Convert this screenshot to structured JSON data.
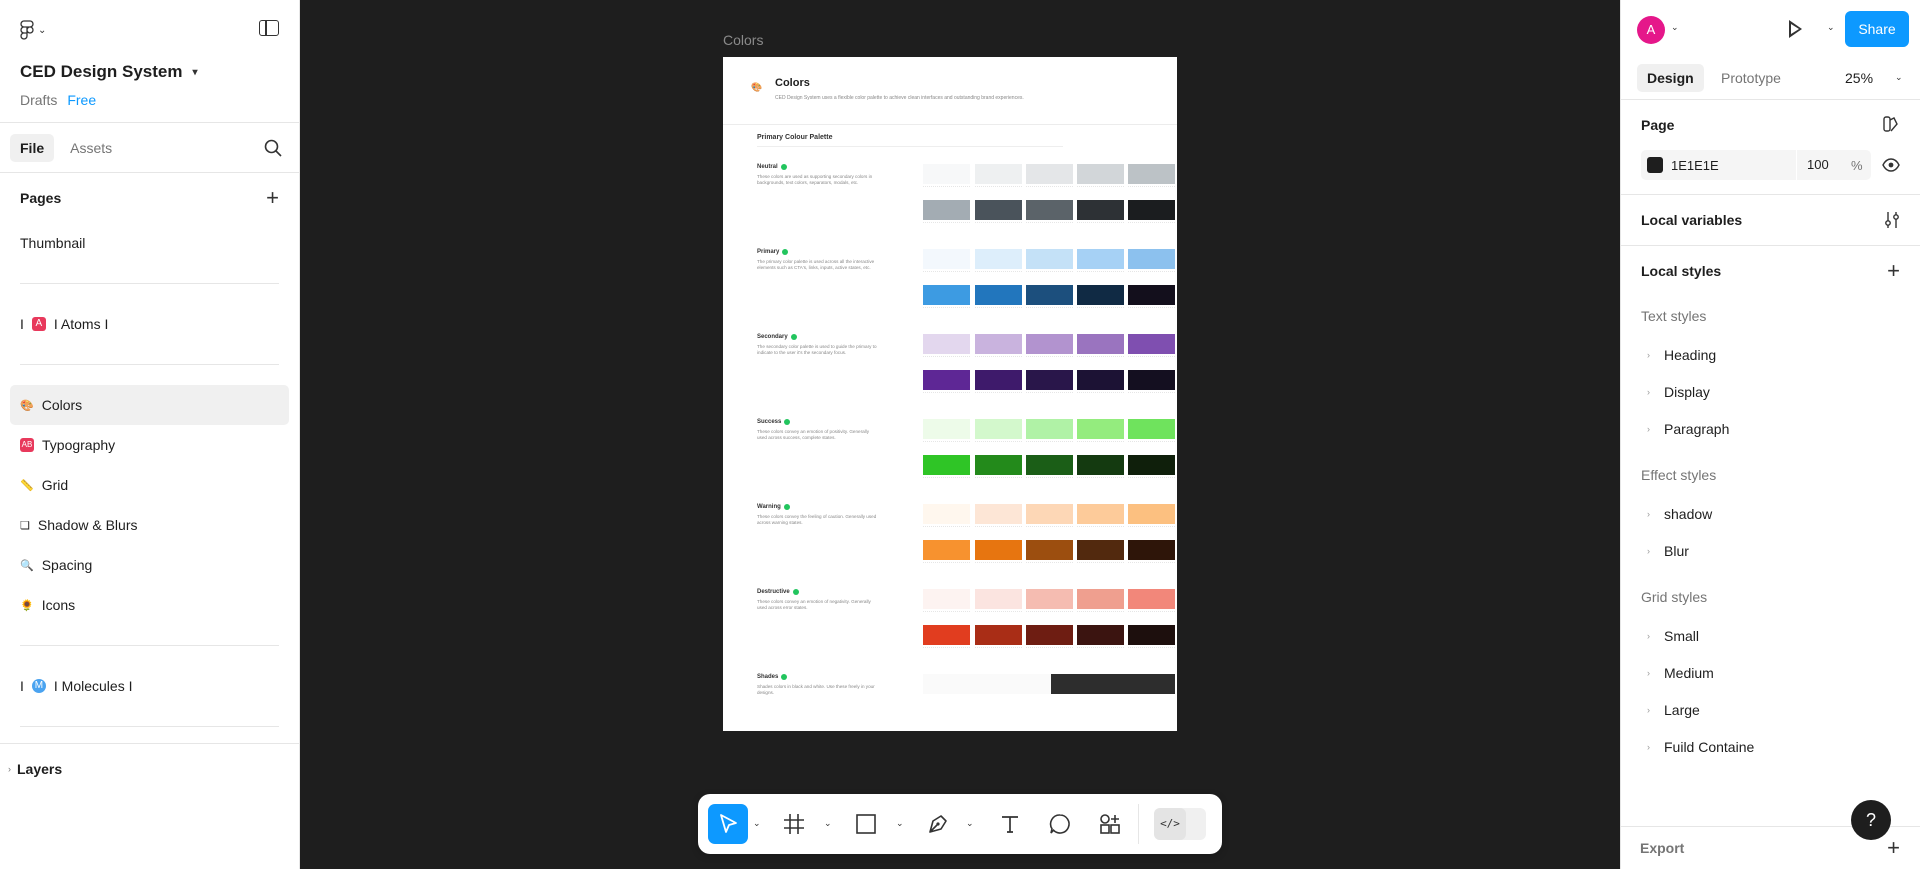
{
  "left": {
    "project_name": "CED Design System",
    "drafts": "Drafts",
    "plan": "Free",
    "tabs": [
      "File",
      "Assets"
    ],
    "pages_heading": "Pages",
    "pages": [
      {
        "label": "Thumbnail",
        "icon": ""
      },
      {
        "label": "I Atoms I",
        "icon": "atoms-icon",
        "prefix": "I"
      },
      {
        "label": "Colors",
        "icon": "palette-icon"
      },
      {
        "label": "Typography",
        "icon": "typography-icon"
      },
      {
        "label": "Grid",
        "icon": "ruler-icon"
      },
      {
        "label": "Shadow & Blurs",
        "icon": "square-icon"
      },
      {
        "label": "Spacing",
        "icon": "magnifier-icon"
      },
      {
        "label": "Icons",
        "icon": "sunflower-icon"
      },
      {
        "label": "I Molecules I",
        "icon": "molecule-icon",
        "prefix": "I"
      }
    ],
    "layers": "Layers"
  },
  "canvas": {
    "frame_label": "Colors",
    "frame": {
      "title": "Colors",
      "description": "CED Design System uses a flexible color palette to achieve clean interfaces and outstanding brand experiences.",
      "subtitle": "Primary Colour Palette",
      "groups": [
        {
          "name": "Neutral",
          "desc": "These colors are used as supporting secondary colors in backgrounds, text colors, separators, modals, etc.",
          "row1": [
            "#f7f8f9",
            "#eef0f1",
            "#e4e6e8",
            "#d2d6d9",
            "#bcc2c6"
          ],
          "row2": [
            "#a3acb3",
            "#4a535b",
            "#5b6369",
            "#2d3135",
            "#1b1d1f"
          ]
        },
        {
          "name": "Primary",
          "desc": "The primary color palette is used across all the interactive elements such as CTA's, links, inputs, active states, etc.",
          "row1": [
            "#f3f8fd",
            "#ddeefb",
            "#c4e1f7",
            "#a6d1f5",
            "#8cc1ee"
          ],
          "row2": [
            "#3d9be2",
            "#2276bd",
            "#1c4f7d",
            "#102a44",
            "#130f1c"
          ]
        },
        {
          "name": "Secondary",
          "desc": "The secondary color palette is used to guide the primary to indicate to the user it's the secondary focus.",
          "row1": [
            "#e3d7ee",
            "#c9b3de",
            "#b293cf",
            "#9a74bf",
            "#7f4fb0"
          ],
          "row2": [
            "#5e2795",
            "#3e1a6b",
            "#29164a",
            "#1c1234",
            "#140f20"
          ]
        },
        {
          "name": "Success",
          "desc": "These colors convey an emotion of positivity. Generally used across success, complete states.",
          "row1": [
            "#edfbe9",
            "#d3f8cc",
            "#b0f2a6",
            "#94ec7e",
            "#6fe35d"
          ],
          "row2": [
            "#2fc526",
            "#238a1b",
            "#1b5e17",
            "#143a10",
            "#0f1f0b"
          ]
        },
        {
          "name": "Warning",
          "desc": "These colors convey the feeling of caution. Generally used across warning states.",
          "row1": [
            "#fff7ee",
            "#fde6d6",
            "#fdd7b6",
            "#fdcb9a",
            "#fcc080"
          ],
          "row2": [
            "#f7922f",
            "#e77510",
            "#9c4e0f",
            "#52290e",
            "#2e1509"
          ]
        },
        {
          "name": "Destructive",
          "desc": "These colors convey an emotion of negativity. Generally used across error states.",
          "row1": [
            "#fdf3f1",
            "#fbe4e0",
            "#f5bcb1",
            "#ef9f8f",
            "#f2877a"
          ],
          "row2": [
            "#e13d1f",
            "#a92d16",
            "#6e1d12",
            "#3b1410",
            "#1d0f0d"
          ]
        },
        {
          "name": "Shades",
          "desc": "Shades colors in black and white. Use these freely in your designs."
        }
      ]
    }
  },
  "toolbar": {
    "tools": [
      "move-tool",
      "frame-tool",
      "shape-tool",
      "pen-tool",
      "text-tool",
      "comment-tool",
      "actions-tool"
    ],
    "dev_mode": "</>"
  },
  "right": {
    "avatar_initial": "A",
    "share": "Share",
    "tabs": [
      "Design",
      "Prototype"
    ],
    "zoom": "25%",
    "page_heading": "Page",
    "page_color": "1E1E1E",
    "page_opacity": "100",
    "page_opacity_unit": "%",
    "local_variables": "Local variables",
    "local_styles": "Local styles",
    "text_styles_heading": "Text styles",
    "text_styles": [
      "Heading",
      "Display",
      "Paragraph"
    ],
    "effect_styles_heading": "Effect styles",
    "effect_styles": [
      "shadow",
      "Blur"
    ],
    "grid_styles_heading": "Grid styles",
    "grid_styles": [
      "Small",
      "Medium",
      "Large",
      "Fuild Containe"
    ],
    "export": "Export",
    "help": "?"
  },
  "colors": {
    "accent": "#0d99ff",
    "canvas_bg": "#1e1e1e",
    "avatar": "#e5178a"
  }
}
